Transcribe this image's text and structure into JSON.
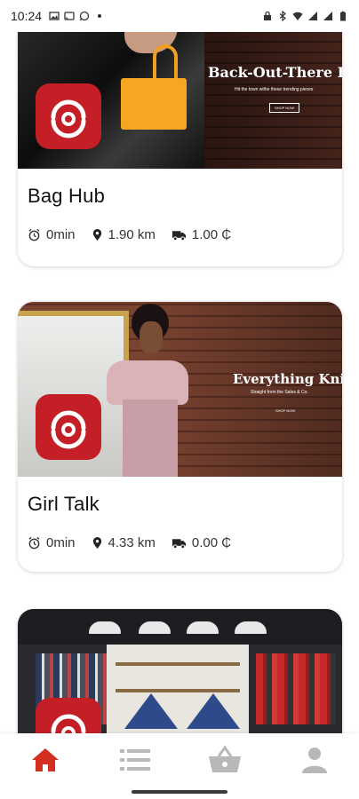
{
  "status_bar": {
    "time": "10:24",
    "left_icons": [
      "image-icon",
      "cast-icon",
      "whatsapp-icon",
      "dot-icon"
    ],
    "right_icons": [
      "lock-icon",
      "bluetooth-icon",
      "wifi-icon",
      "signal-icon",
      "signal-icon",
      "battery-icon"
    ]
  },
  "stores": [
    {
      "name": "Bag Hub",
      "time": "0min",
      "distance": "1.90 km",
      "delivery_fee": "1.00 ₵",
      "banner": {
        "title": "Back-Out-There B",
        "subtitle": "Hit the town withe these trending pieces",
        "button": "SHOP NOW"
      }
    },
    {
      "name": "Girl Talk",
      "time": "0min",
      "distance": "4.33 km",
      "delivery_fee": "0.00 ₵",
      "banner": {
        "title": "Everything Knit",
        "subtitle": "Straight from the Sales & Co.",
        "button": "SHOP NOW"
      }
    },
    {
      "name": "",
      "banner": {}
    }
  ],
  "bottom_nav": [
    "home-icon",
    "list-icon",
    "basket-icon",
    "profile-icon"
  ],
  "colors": {
    "accent": "#d32f1f",
    "brand_badge": "#c41f26",
    "nav_inactive": "#b8b8b8"
  }
}
